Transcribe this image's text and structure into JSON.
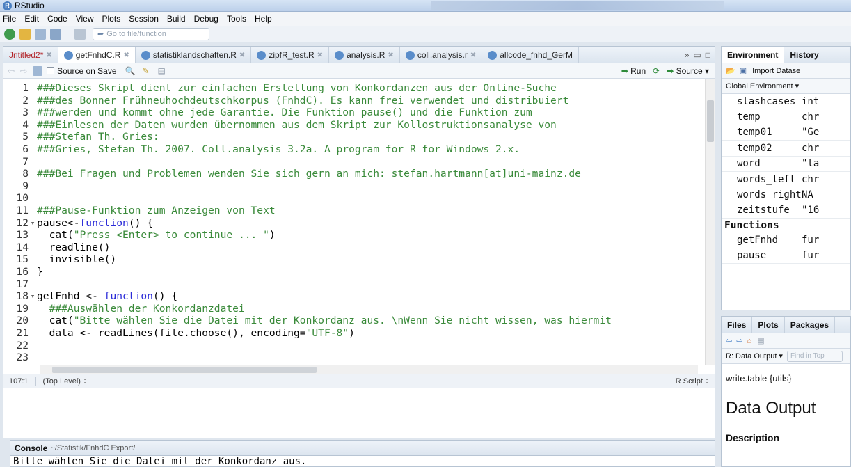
{
  "titlebar": {
    "title": "RStudio"
  },
  "menu": [
    "File",
    "Edit",
    "Code",
    "View",
    "Plots",
    "Session",
    "Build",
    "Debug",
    "Tools",
    "Help"
  ],
  "toolbar": {
    "goto_placeholder": "Go to file/function"
  },
  "editor": {
    "tabs": [
      {
        "label": "Jntitled2*",
        "active": false
      },
      {
        "label": "getFnhdC.R",
        "active": true
      },
      {
        "label": "statistiklandschaften.R",
        "active": false
      },
      {
        "label": "zipfR_test.R",
        "active": false
      },
      {
        "label": "analysis.R",
        "active": false
      },
      {
        "label": "coll.analysis.r",
        "active": false
      },
      {
        "label": "allcode_fnhd_GerM",
        "active": false
      }
    ],
    "more_tabs": "»",
    "source_on_save": "Source on Save",
    "run_label": "Run",
    "source_label": "Source",
    "lines": [
      {
        "n": "1",
        "fold": "",
        "html": "<span class=\"cm\">###Dieses Skript dient zur einfachen Erstellung von Konkordanzen aus der Online-Suche</span>"
      },
      {
        "n": "2",
        "fold": "",
        "html": "<span class=\"cm\">###des Bonner Frühneuhochdeutschkorpus (FnhdC). Es kann frei verwendet und distribuiert</span>"
      },
      {
        "n": "3",
        "fold": "",
        "html": "<span class=\"cm\">###werden und kommt ohne jede Garantie. Die Funktion pause() und die Funktion zum</span>"
      },
      {
        "n": "4",
        "fold": "",
        "html": "<span class=\"cm\">###Einlesen der Daten wurden übernommen aus dem Skript zur Kollostruktionsanalyse von</span>"
      },
      {
        "n": "5",
        "fold": "",
        "html": "<span class=\"cm\">###Stefan Th. Gries:</span>"
      },
      {
        "n": "6",
        "fold": "",
        "html": "<span class=\"cm\">###Gries, Stefan Th. 2007. Coll.analysis 3.2a. A program for R for Windows 2.x.</span>"
      },
      {
        "n": "7",
        "fold": "",
        "html": ""
      },
      {
        "n": "8",
        "fold": "",
        "html": "<span class=\"cm\">###Bei Fragen und Problemen wenden Sie sich gern an mich: stefan.hartmann[at]uni-mainz.de</span>"
      },
      {
        "n": "9",
        "fold": "",
        "html": ""
      },
      {
        "n": "10",
        "fold": "",
        "html": ""
      },
      {
        "n": "11",
        "fold": "",
        "html": "<span class=\"cm\">###Pause-Funktion zum Anzeigen von Text</span>"
      },
      {
        "n": "12",
        "fold": "▾",
        "html": "pause&lt;-<span class=\"kw\">function</span>() {"
      },
      {
        "n": "13",
        "fold": "",
        "html": "  cat(<span class=\"st\">\"Press &lt;Enter&gt; to continue ... \"</span>)"
      },
      {
        "n": "14",
        "fold": "",
        "html": "  readline()"
      },
      {
        "n": "15",
        "fold": "",
        "html": "  invisible()"
      },
      {
        "n": "16",
        "fold": "",
        "html": "}"
      },
      {
        "n": "17",
        "fold": "",
        "html": ""
      },
      {
        "n": "18",
        "fold": "▾",
        "html": "getFnhd &lt;- <span class=\"kw\">function</span>() {"
      },
      {
        "n": "19",
        "fold": "",
        "html": "  <span class=\"cm\">###Auswählen der Konkordanzdatei</span>"
      },
      {
        "n": "20",
        "fold": "",
        "html": "  cat(<span class=\"st\">\"Bitte wählen Sie die Datei mit der Konkordanz aus. \\nWenn Sie nicht wissen, was hiermit</span>"
      },
      {
        "n": "21",
        "fold": "",
        "html": "  data &lt;- readLines(file.choose(), encoding=<span class=\"st\">\"UTF-8\"</span>)"
      },
      {
        "n": "22",
        "fold": "",
        "html": ""
      },
      {
        "n": "23",
        "fold": "",
        "html": ""
      }
    ],
    "hscroll_label": "III",
    "status_pos": "107:1",
    "status_scope": "(Top Level) ÷",
    "status_type": "R Script ÷"
  },
  "console": {
    "title": "Console",
    "path": "~/Statistik/FnhdC Export/",
    "output": "Bitte wählen Sie die Datei mit der Konkordanz aus."
  },
  "environment": {
    "tabs": [
      "Environment",
      "History"
    ],
    "import_label": "Import Datase",
    "scope_label": "Global Environment ▾",
    "rows": [
      {
        "name": "slashcases",
        "value": "int"
      },
      {
        "name": "temp",
        "value": "chr"
      },
      {
        "name": "temp01",
        "value": "\"Ge"
      },
      {
        "name": "temp02",
        "value": "chr"
      },
      {
        "name": "word",
        "value": "\"la"
      },
      {
        "name": "words_left",
        "value": "chr"
      },
      {
        "name": "words_right",
        "value": "NA_"
      },
      {
        "name": "zeitstufe",
        "value": "\"16"
      }
    ],
    "functions_header": "Functions",
    "functions": [
      {
        "name": "getFnhd",
        "value": "fur"
      },
      {
        "name": "pause",
        "value": "fur"
      }
    ]
  },
  "files": {
    "tabs": [
      "Files",
      "Plots",
      "Packages"
    ],
    "output_label": "R: Data Output ▾",
    "find_placeholder": "Find in Top",
    "help_pkg": "write.table {utils}",
    "help_title": "Data Output",
    "help_section": "Description"
  }
}
